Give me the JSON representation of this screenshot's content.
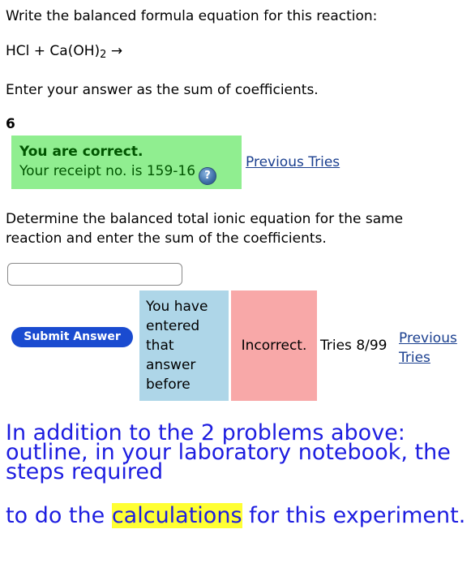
{
  "question1": {
    "prompt": "Write the balanced formula equation for this reaction:",
    "equation_main": "HCl + Ca(OH)",
    "equation_sub": "2",
    "equation_arrow": " →",
    "instruction": "Enter your answer as the sum of coefficients.",
    "answer": "6",
    "feedback": {
      "title": "You are correct.",
      "receipt": "Your receipt no. is 159-16",
      "help_icon": "?",
      "color": "#90ee90"
    },
    "previous_tries_label": "Previous Tries"
  },
  "question2": {
    "prompt": "Determine the balanced total ionic equation for the same reaction and enter the sum of the coefficients.",
    "input_value": "",
    "submit_label": "Submit Answer",
    "entered_message": "You have entered that answer before",
    "incorrect_label": "Incorrect.",
    "tries": "Tries 8/99",
    "previous_tries_label": "Previous Tries"
  },
  "notes": {
    "line1": "In addition to the 2 problems above: outline, in your laboratory notebook, the steps required",
    "line2_prefix": "to do the ",
    "line2_highlight": "calculations",
    "line2_suffix": " for this experiment."
  },
  "colors": {
    "correct_bg": "#90ee90",
    "entered_bg": "#aed6e8",
    "incorrect_bg": "#f8a8a8",
    "link": "#1a3f8f",
    "submit_bg": "#1a4bd0",
    "note_text": "#1d1de0",
    "highlight": "#ffff33"
  }
}
